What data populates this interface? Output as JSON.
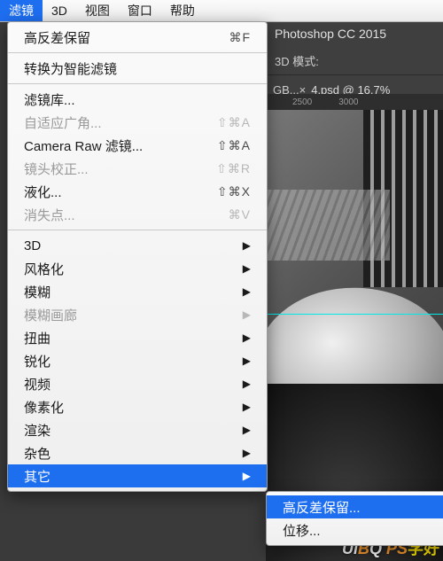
{
  "menubar": {
    "items": [
      "滤镜",
      "3D",
      "视图",
      "窗口",
      "帮助"
    ]
  },
  "dropdown": {
    "last_filter": {
      "label": "高反差保留",
      "shortcut": "⌘F"
    },
    "smart": "转换为智能滤镜",
    "gallery": "滤镜库...",
    "adaptive": {
      "label": "自适应广角...",
      "shortcut": "⇧⌘A"
    },
    "camera_raw": {
      "label": "Camera Raw 滤镜...",
      "shortcut": "⇧⌘A"
    },
    "lens": {
      "label": "镜头校正...",
      "shortcut": "⇧⌘R"
    },
    "liquify": {
      "label": "液化...",
      "shortcut": "⇧⌘X"
    },
    "vanish": {
      "label": "消失点...",
      "shortcut": "⌘V"
    },
    "groups": [
      "3D",
      "风格化",
      "模糊",
      "模糊画廊",
      "扭曲",
      "锐化",
      "视频",
      "像素化",
      "渲染",
      "杂色",
      "其它"
    ]
  },
  "submenu": {
    "items": [
      "高反差保留...",
      "位移..."
    ]
  },
  "app": {
    "title": "Photoshop CC 2015",
    "mode_label": "3D 模式:",
    "tab_prefix": "GB...",
    "tab_name": "4.psd @ 16.7%",
    "ruler": [
      "2500",
      "3000"
    ]
  },
  "watermark": {
    "u": "Ui",
    "b": "B",
    "q": "Q",
    "ps": "PS",
    "cn": "学好"
  }
}
